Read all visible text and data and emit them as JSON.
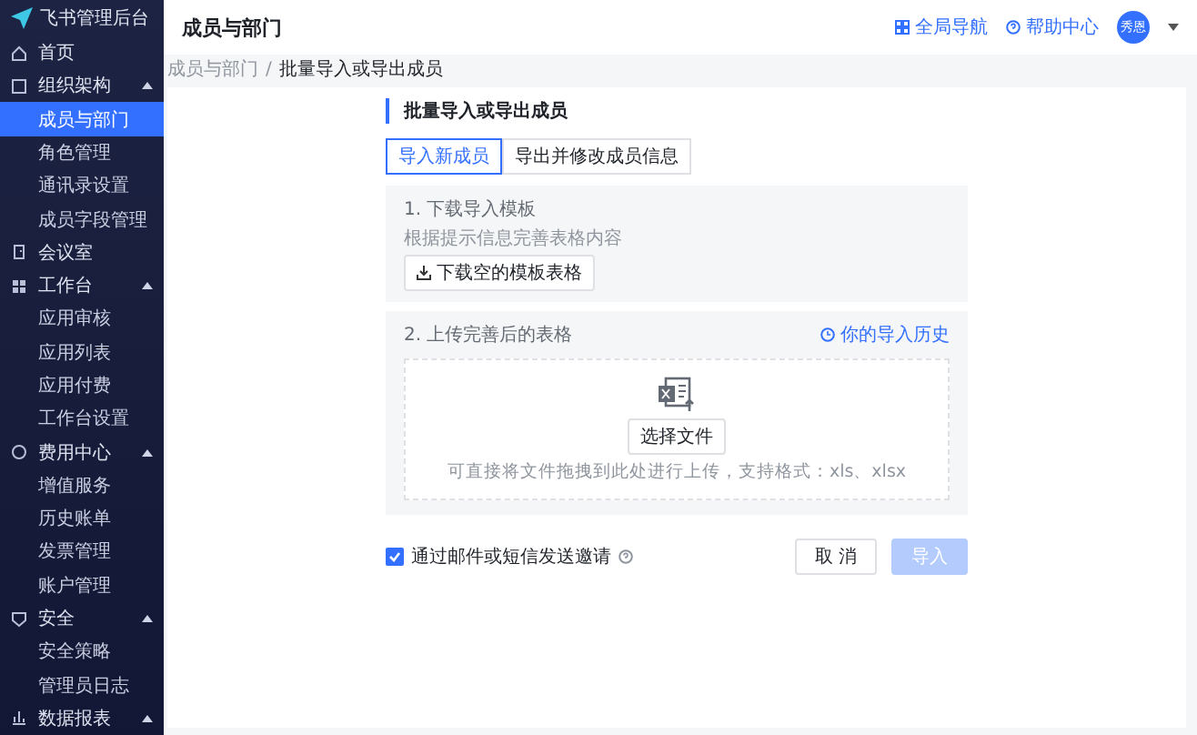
{
  "sidebar": {
    "title": "飞书管理后台",
    "items": [
      {
        "label": "首页",
        "selected": false
      },
      {
        "label": "组织架构",
        "expanded": true,
        "selected": false,
        "children": [
          {
            "label": "成员与部门",
            "selected": true
          },
          {
            "label": "角色管理",
            "selected": false
          },
          {
            "label": "通讯录设置",
            "selected": false
          },
          {
            "label": "成员字段管理",
            "selected": false
          }
        ]
      },
      {
        "label": "会议室",
        "selected": false
      },
      {
        "label": "工作台",
        "expanded": true,
        "selected": false,
        "children": [
          {
            "label": "应用审核",
            "selected": false
          },
          {
            "label": "应用列表",
            "selected": false
          },
          {
            "label": "应用付费",
            "selected": false
          },
          {
            "label": "工作台设置",
            "selected": false
          }
        ]
      },
      {
        "label": "费用中心",
        "expanded": true,
        "selected": false,
        "children": [
          {
            "label": "增值服务",
            "selected": false
          },
          {
            "label": "历史账单",
            "selected": false
          },
          {
            "label": "发票管理",
            "selected": false
          },
          {
            "label": "账户管理",
            "selected": false
          }
        ]
      },
      {
        "label": "安全",
        "expanded": true,
        "selected": false,
        "children": [
          {
            "label": "安全策略",
            "selected": false
          },
          {
            "label": "管理员日志",
            "selected": false
          }
        ]
      },
      {
        "label": "数据报表",
        "expanded": true,
        "selected": false
      }
    ]
  },
  "header": {
    "title": "成员与部门",
    "links": [
      "全局导航",
      "帮助中心"
    ],
    "avatar": "秀恩"
  },
  "breadcrumb": {
    "items": [
      "成员与部门",
      "批量导入或导出成员"
    ],
    "separator": "/"
  },
  "section_title": "批量导入或导出成员",
  "tabs": [
    {
      "label": "导入新成员",
      "selected": true
    },
    {
      "label": "导出并修改成员信息",
      "selected": false
    }
  ],
  "step1": {
    "title": "1. 下载导入模板",
    "hint": "根据提示信息完善表格内容",
    "button": "下载空的模板表格"
  },
  "step2": {
    "title": "2. 上传完善后的表格",
    "history_link": "你的导入历史",
    "choose_button": "选择文件",
    "drop_hint": "可直接将文件拖拽到此处进行上传，支持格式：xls、xlsx"
  },
  "invite": {
    "label": "通过邮件或短信发送邀请",
    "checked": true
  },
  "buttons": [
    {
      "label": "取 消",
      "kind": "secondary",
      "disabled": false
    },
    {
      "label": "导入",
      "kind": "primary",
      "disabled": true
    }
  ]
}
